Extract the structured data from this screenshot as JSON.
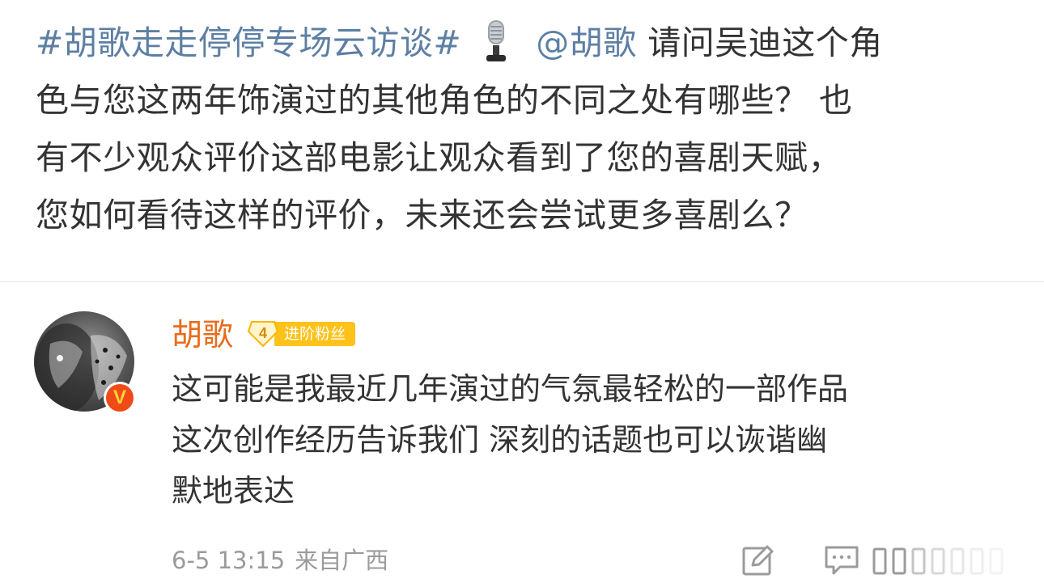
{
  "post": {
    "hashtag": "#胡歌走走停停专场云访谈#",
    "mention": "@胡歌",
    "text_line1": " 请问吴迪这个角",
    "text_line2": "色与您这两年饰演过的其他角色的不同之处有哪些？ 也",
    "text_line3": "有不少观众评价这部电影让观众看到了您的喜剧天赋，",
    "text_line4": "您如何看待这样的评价，未来还会尝试更多喜剧么？",
    "emoji_icon": "microphone-icon"
  },
  "comment": {
    "username": "胡歌",
    "fan_level": "4",
    "fan_label": "进阶粉丝",
    "verified_icon": "verified-v-icon",
    "lines": [
      "这可能是我最近几年演过的气氛最轻松的一部作品",
      "这次创作经历告诉我们 深刻的话题也可以诙谐幽",
      "默地表达"
    ],
    "date": "6-5 13:15",
    "source": "来自广西"
  },
  "actions": {
    "repost_icon": "repost-icon",
    "comment_icon": "comment-icon",
    "like_icon": "like-icon"
  },
  "colors": {
    "link": "#5d7fa4",
    "username": "#e86c1a",
    "badge_bg": "#ffc21a",
    "verified_bg": "#f04a17",
    "meta_text": "#9b9b9b"
  }
}
